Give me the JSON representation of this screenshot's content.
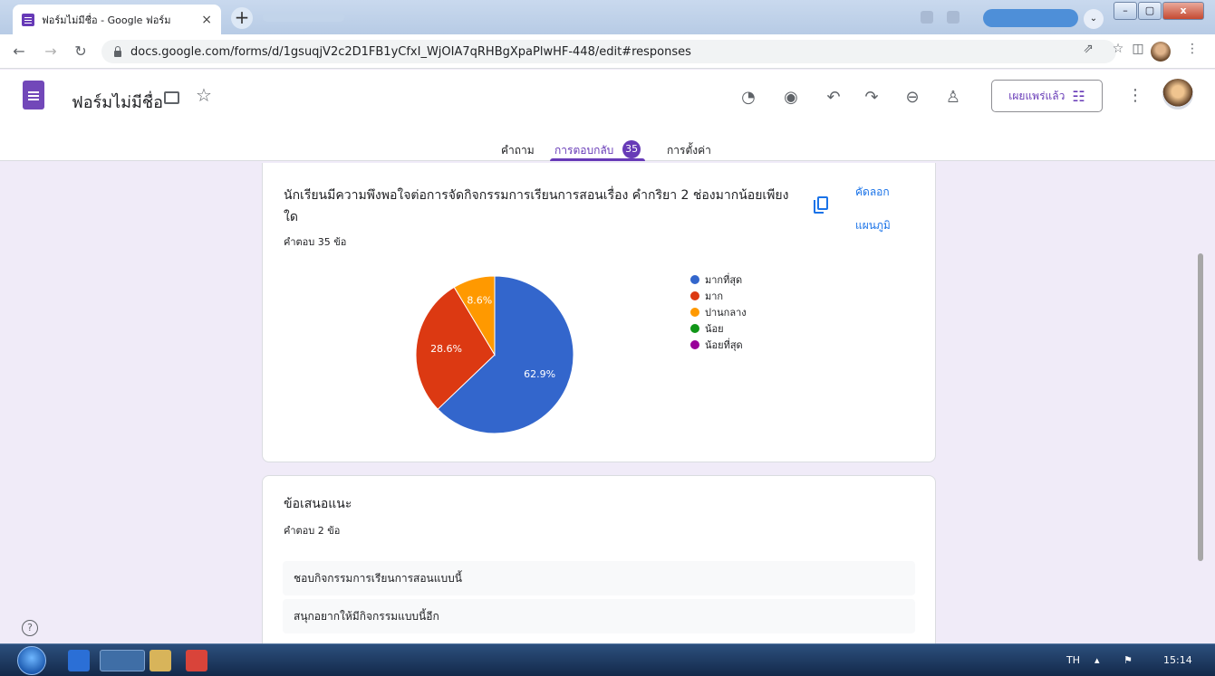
{
  "browser": {
    "tab_title": "ฟอร์มไม่มีชื่อ - Google ฟอร์ม",
    "tab_close": "×",
    "new_tab": "+",
    "url": "docs.google.com/forms/d/1gsuqjV2c2D1FB1yCfxI_WjOIA7qRHBgXpaPlwHF-448/edit#responses",
    "window_controls": [
      "–",
      "▢",
      "x"
    ]
  },
  "forms": {
    "form_title": "ฟอร์มไม่มีชื่อ",
    "publish_label": "เผยแพร่แล้ว",
    "tabs": [
      {
        "label": "คำถาม"
      },
      {
        "label": "การตอบกลับ",
        "badge": "35"
      },
      {
        "label": "การตั้งค่า"
      }
    ]
  },
  "question1": {
    "title": "นักเรียนมีความพึงพอใจต่อการจัดกิจกรรมการเรียนการสอนเรื่อง คำกริยา 2 ช่องมากน้อยเพียงใด",
    "count": "คำตอบ 35 ข้อ",
    "copy_label_line1": "คัดลอก",
    "copy_label_line2": "แผนภูมิ"
  },
  "chart_data": {
    "type": "pie",
    "categories": [
      "มากที่สุด",
      "มาก",
      "ปานกลาง",
      "น้อย",
      "น้อยที่สุด"
    ],
    "values": [
      62.9,
      28.6,
      8.6,
      0,
      0
    ],
    "labels": [
      "62.9%",
      "28.6%",
      "8.6%",
      "",
      ""
    ],
    "colors": [
      "#3366cc",
      "#dc3912",
      "#ff9900",
      "#109618",
      "#990099"
    ],
    "legend_position": "right"
  },
  "question2": {
    "title": "ข้อเสนอแนะ",
    "count": "คำตอบ 2 ข้อ",
    "answers": [
      "ชอบกิจกรรมการเรียนการสอนแบบนี้",
      "สนุกอยากให้มีกิจกรรมแบบนี้อีก"
    ]
  },
  "taskbar": {
    "language": "TH",
    "time": "15:14"
  }
}
